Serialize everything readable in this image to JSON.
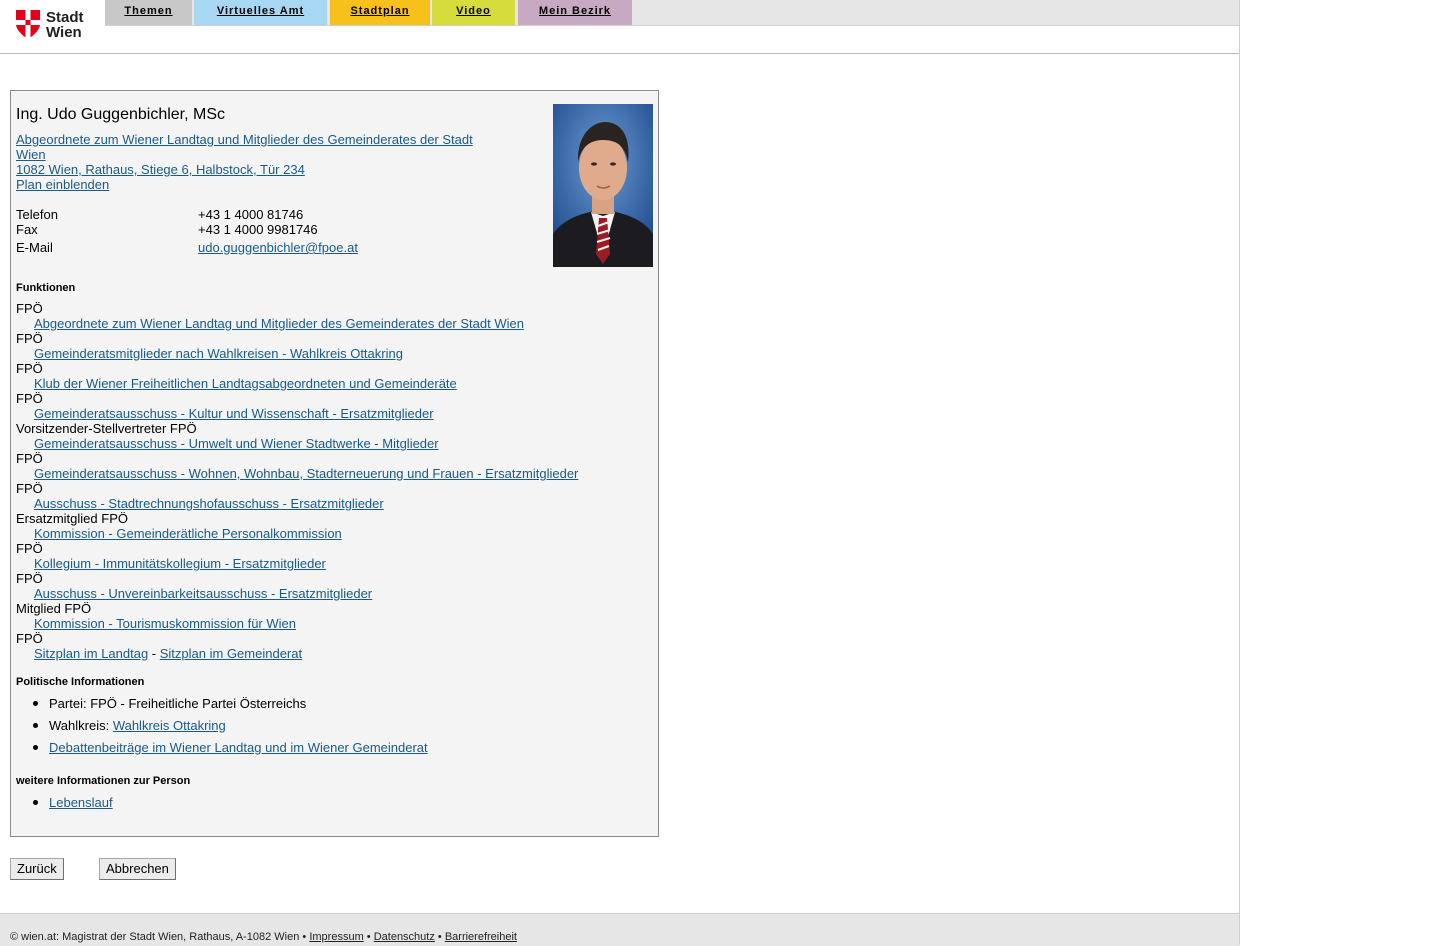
{
  "header": {
    "logo_line1": "Stadt",
    "logo_line2": "Wien",
    "tabs": [
      {
        "label": "Themen",
        "color": "#c8c8c8"
      },
      {
        "label": "Virtuelles Amt",
        "color": "#a7d7f2"
      },
      {
        "label": "Stadtplan",
        "color": "#f7c01b"
      },
      {
        "label": "Video",
        "color": "#d5dc3c"
      },
      {
        "label": "Mein Bezirk",
        "color": "#c8a9c3"
      }
    ]
  },
  "person": {
    "name": "Ing. Udo Guggenbichler, MSc",
    "subtitle": "Abgeordnete zum Wiener Landtag und Mitglieder des Gemeinderates der Stadt Wien",
    "address": "1082 Wien, Rathaus, Stiege 6, Halbstock, Tür 234",
    "plan": "Plan einblenden",
    "contacts": [
      {
        "label": "Telefon",
        "value": "+43 1 4000 81746"
      },
      {
        "label": "Fax",
        "value": "+43 1 4000 9981746"
      },
      {
        "label": "E-Mail",
        "value": "udo.guggenbichler@fpoe.at"
      }
    ]
  },
  "functions": {
    "heading": "Funktionen",
    "items": [
      {
        "role": "FPÖ",
        "org": "Abgeordnete zum Wiener Landtag und Mitglieder des Gemeinderates der Stadt Wien"
      },
      {
        "role": "FPÖ",
        "org": "Gemeinderatsmitglieder nach Wahlkreisen - Wahlkreis Ottakring"
      },
      {
        "role": "FPÖ",
        "org": "Klub der Wiener Freiheitlichen Landtagsabgeordneten und Gemeinderäte"
      },
      {
        "role": "FPÖ",
        "org": "Gemeinderatsausschuss - Kultur und Wissenschaft - Ersatzmitglieder"
      },
      {
        "role": "Vorsitzender-Stellvertreter FPÖ",
        "org": "Gemeinderatsausschuss - Umwelt und Wiener Stadtwerke - Mitglieder"
      },
      {
        "role": "FPÖ",
        "org": "Gemeinderatsausschuss - Wohnen, Wohnbau, Stadterneuerung und Frauen - Ersatzmitglieder"
      },
      {
        "role": "FPÖ",
        "org": "Ausschuss - Stadtrechnungshofausschuss - Ersatzmitglieder"
      },
      {
        "role": "Ersatzmitglied FPÖ",
        "org": "Kommission - Gemeinderätliche Personalkommission"
      },
      {
        "role": "FPÖ",
        "org": "Kollegium - Immunitätskollegium - Ersatzmitglieder"
      },
      {
        "role": "FPÖ",
        "org": "Ausschuss - Unvereinbarkeitsausschuss - Ersatzmitglieder"
      },
      {
        "role": "Mitglied FPÖ",
        "org": "Kommission - Tourismuskommission für Wien"
      }
    ],
    "last_role": "FPÖ",
    "sitzplan_landtag": "Sitzplan im Landtag",
    "sitzplan_sep": " - ",
    "sitzplan_gemeinderat": "Sitzplan im Gemeinderat"
  },
  "political": {
    "heading": "Politische Informationen",
    "partei_label": "Partei: ",
    "partei_value": "FPÖ - Freiheitliche Partei Österreichs",
    "wahlkreis_label": "Wahlkreis: ",
    "wahlkreis_value": "Wahlkreis Ottakring",
    "debatten": "Debattenbeiträge im Wiener Landtag und im Wiener Gemeinderat"
  },
  "further": {
    "heading": "weitere Informationen zur Person",
    "lebenslauf": "Lebenslauf"
  },
  "buttons": {
    "back": "Zurück",
    "cancel": "Abbrechen"
  },
  "footer": {
    "text": "© wien.at: Magistrat der Stadt Wien, Rathaus, A-1082 Wien",
    "bullet": " • ",
    "impressum": "Impressum",
    "datenschutz": "Datenschutz",
    "barrierefreiheit": "Barrierefreiheit"
  }
}
